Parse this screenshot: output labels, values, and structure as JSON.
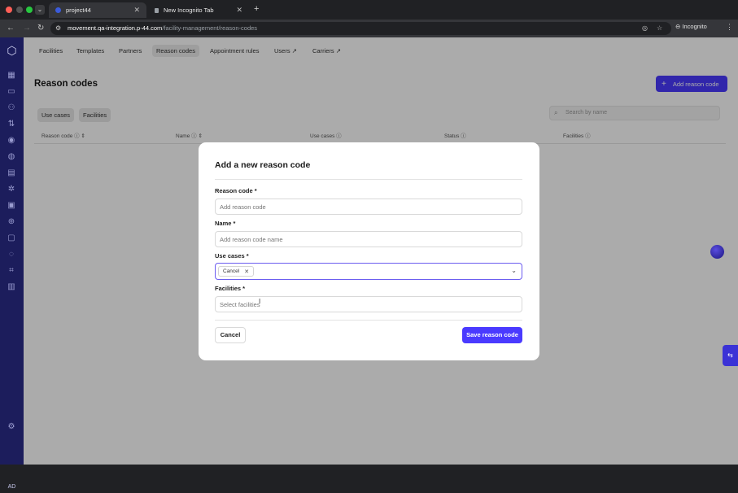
{
  "browser": {
    "tabs": [
      {
        "label": "project44",
        "active": true
      },
      {
        "label": "New Incognito Tab",
        "active": false
      }
    ],
    "url_host": "movement.qa-integration.p-44.com",
    "url_path": "/facility-management/reason-codes",
    "incognito_label": "Incognito"
  },
  "sidebar": {
    "icons": [
      "logo-icon",
      "dashboard-icon",
      "chat-icon",
      "users-icon",
      "routes-icon",
      "eye-icon",
      "globe-icon",
      "chart-icon",
      "network-icon",
      "calendar-icon",
      "world-icon",
      "message-icon",
      "pin-icon",
      "scan-icon",
      "schedule-icon",
      "settings-icon"
    ],
    "avatar": "AD"
  },
  "topnav": {
    "items": [
      {
        "label": "Facilities"
      },
      {
        "label": "Templates"
      },
      {
        "label": "Partners"
      },
      {
        "label": "Reason codes",
        "active": true
      },
      {
        "label": "Appointment rules"
      },
      {
        "label": "Users ↗"
      },
      {
        "label": "Carriers ↗"
      }
    ]
  },
  "page": {
    "title": "Reason codes",
    "add_button": "Add reason code",
    "segments": [
      "Use cases",
      "Facilities"
    ],
    "search_placeholder": "Search by name",
    "columns": [
      "Reason code",
      "Name",
      "Use cases",
      "Status",
      "Facilities"
    ]
  },
  "modal": {
    "title": "Add a new reason code",
    "reason_code_label": "Reason code *",
    "reason_code_placeholder": "Add reason code",
    "name_label": "Name *",
    "name_placeholder": "Add reason code name",
    "use_cases_label": "Use cases *",
    "use_case_chip": "Cancel",
    "facilities_label": "Facilities *",
    "facilities_placeholder": "Select facilities",
    "cancel_button": "Cancel",
    "save_button": "Save reason code"
  },
  "colors": {
    "accent": "#4a3aff",
    "sidebar": "#1c1d5c"
  }
}
